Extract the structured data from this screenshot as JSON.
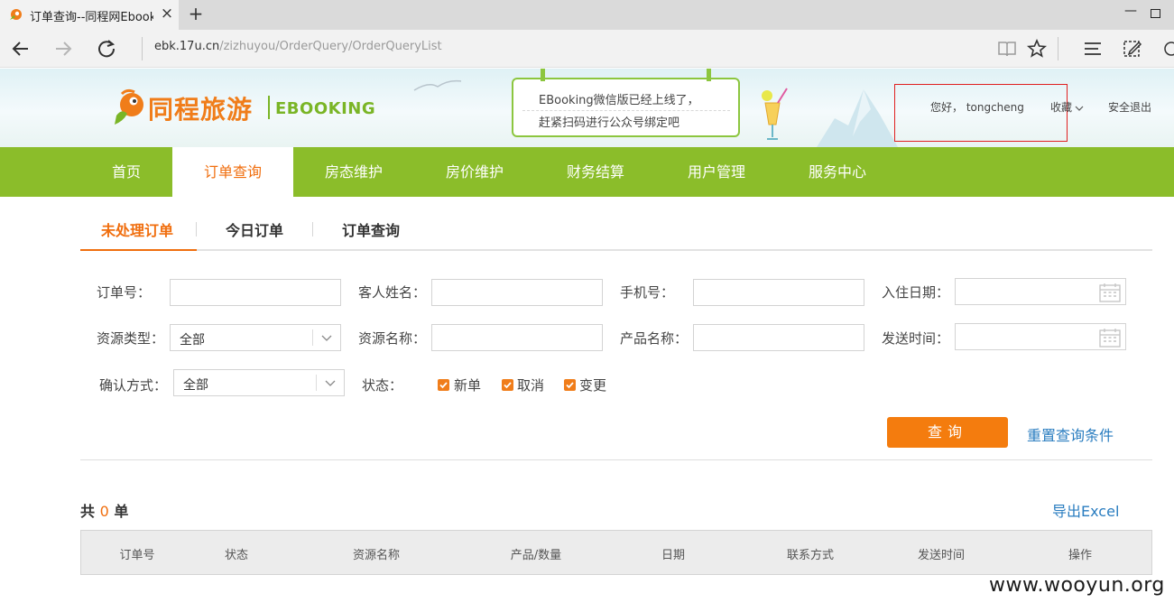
{
  "browser": {
    "tab_title": "订单查询--同程网Ebooking",
    "url_host": "ebk.17u.cn",
    "url_path": "/zizhuyou/OrderQuery/OrderQueryList"
  },
  "header": {
    "logo_text": "同程旅游",
    "logo_sub": "EBOOKING",
    "notice_line1": "EBooking微信版已经上线了，",
    "notice_line2": "赶紧扫码进行公众号绑定吧",
    "greeting": "您好， tongcheng",
    "favorites": "收藏",
    "logout": "安全退出"
  },
  "nav": {
    "items": [
      {
        "label": "首页"
      },
      {
        "label": "订单查询"
      },
      {
        "label": "房态维护"
      },
      {
        "label": "房价维护"
      },
      {
        "label": "财务结算"
      },
      {
        "label": "用户管理"
      },
      {
        "label": "服务中心"
      }
    ],
    "active_index": 1
  },
  "subtabs": {
    "items": [
      {
        "label": "未处理订单"
      },
      {
        "label": "今日订单"
      },
      {
        "label": "订单查询"
      }
    ],
    "active_index": 0
  },
  "form": {
    "order_no_label": "订单号：",
    "guest_name_label": "客人姓名：",
    "phone_label": "手机号：",
    "checkin_label": "入住日期：",
    "resource_type_label": "资源类型：",
    "resource_type_value": "全部",
    "resource_name_label": "资源名称：",
    "product_name_label": "产品名称：",
    "send_time_label": "发送时间：",
    "confirm_method_label": "确认方式：",
    "confirm_method_value": "全部",
    "status_label": "状态：",
    "status_options": [
      {
        "label": "新单",
        "checked": true
      },
      {
        "label": "取消",
        "checked": true
      },
      {
        "label": "变更",
        "checked": true
      }
    ],
    "query_button": "查询",
    "reset_link": "重置查询条件"
  },
  "results": {
    "total_prefix": "共",
    "total_count": "0",
    "total_suffix": "单",
    "export_label": "导出Excel",
    "columns": [
      "订单号",
      "状态",
      "资源名称",
      "产品/数量",
      "日期",
      "联系方式",
      "发送时间",
      "操作"
    ],
    "rows": []
  },
  "watermark": "www.wooyun.org",
  "colors": {
    "nav_green": "#8bbd2a",
    "accent_orange": "#f06e0e",
    "link_blue": "#2a7dc0"
  }
}
